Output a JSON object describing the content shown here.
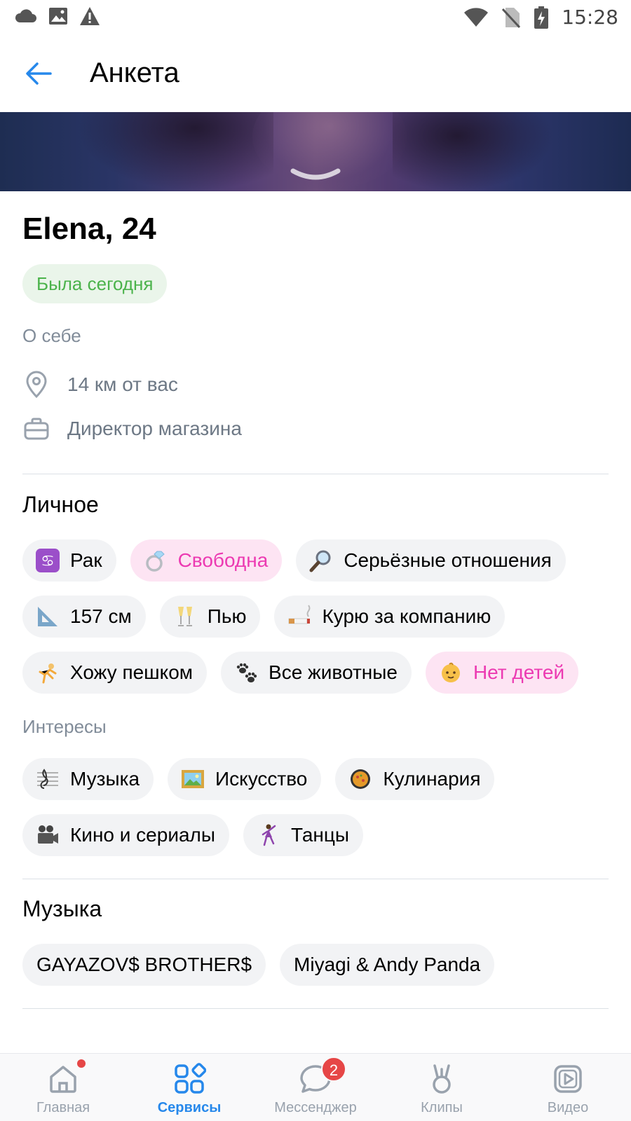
{
  "status_bar": {
    "time": "15:28",
    "icons_left": [
      "cloud-icon",
      "image-icon",
      "warning-icon"
    ],
    "icons_right": [
      "wifi-icon",
      "no-sim-icon",
      "battery-charging-icon"
    ]
  },
  "header": {
    "title": "Анкета",
    "back_icon": "arrow-left-icon"
  },
  "profile": {
    "name": "Elena, 24",
    "online_status": "Была сегодня",
    "about_label": "О себе",
    "distance": "14 км от вас",
    "job": "Директор магазина"
  },
  "personal": {
    "title": "Личное",
    "chips": [
      {
        "emoji": "♋",
        "label": "Рак",
        "highlight": false
      },
      {
        "emoji": "💍",
        "label": "Свободна",
        "highlight": true
      },
      {
        "emoji": "🔎",
        "label": "Серьёзные отношения",
        "highlight": false
      },
      {
        "emoji": "📐",
        "label": "157 см",
        "highlight": false
      },
      {
        "emoji": "🥂",
        "label": "Пью",
        "highlight": false
      },
      {
        "emoji": "🚬",
        "label": "Курю за компанию",
        "highlight": false
      },
      {
        "emoji": "🤸",
        "label": "Хожу пешком",
        "highlight": false
      },
      {
        "emoji": "🐾",
        "label": "Все животные",
        "highlight": false
      },
      {
        "emoji": "👶",
        "label": "Нет детей",
        "highlight": true
      }
    ]
  },
  "interests": {
    "title": "Интересы",
    "chips": [
      {
        "emoji": "🎼",
        "label": "Музыка"
      },
      {
        "emoji": "🖼",
        "label": "Искусство"
      },
      {
        "emoji": "🥘",
        "label": "Кулинария"
      },
      {
        "emoji": "🎥",
        "label": "Кино и сериалы"
      },
      {
        "emoji": "💃",
        "label": "Танцы"
      }
    ]
  },
  "music": {
    "title": "Музыка",
    "artists": [
      "GAYAZOV$ BROTHER$",
      "Miyagi & Andy Panda"
    ]
  },
  "bottom_nav": {
    "items": [
      {
        "label": "Главная",
        "icon": "home-icon",
        "active": false,
        "dot": true
      },
      {
        "label": "Сервисы",
        "icon": "services-icon",
        "active": true
      },
      {
        "label": "Мессенджер",
        "icon": "messenger-icon",
        "active": false,
        "badge": "2"
      },
      {
        "label": "Клипы",
        "icon": "clips-icon",
        "active": false
      },
      {
        "label": "Видео",
        "icon": "video-icon",
        "active": false
      }
    ]
  },
  "colors": {
    "accent": "#2688eb",
    "online_green": "#4bb34b",
    "pink": "#ec3ab2",
    "chip_bg": "#f2f3f5",
    "secondary_text": "#818c99"
  }
}
